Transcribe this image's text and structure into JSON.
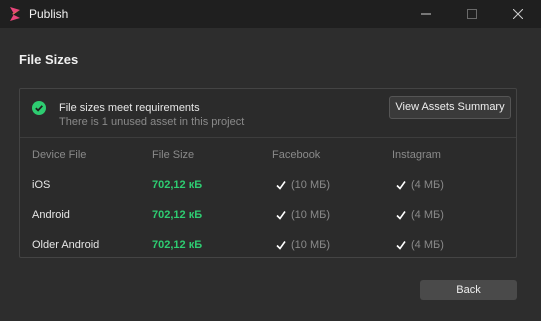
{
  "window": {
    "title": "Publish",
    "icons": {
      "app": "spark-ar-icon",
      "minimize": "minimize-icon",
      "maximize": "maximize-icon",
      "close": "close-icon"
    }
  },
  "page": {
    "title": "File Sizes"
  },
  "status": {
    "title": "File sizes meet requirements",
    "subtitle": "There is 1 unused asset in this project",
    "icon": "check-circle-icon",
    "color": "#2ecc71"
  },
  "summary_button": {
    "label": "View Assets Summary"
  },
  "table": {
    "headers": {
      "device": "Device File",
      "size": "File Size",
      "facebook": "Facebook",
      "instagram": "Instagram"
    },
    "rows": [
      {
        "device": "iOS",
        "size": "702,12 кБ",
        "facebook_limit": "(10 МБ)",
        "instagram_limit": "(4 МБ)"
      },
      {
        "device": "Android",
        "size": "702,12 кБ",
        "facebook_limit": "(10 МБ)",
        "instagram_limit": "(4 МБ)"
      },
      {
        "device": "Older Android",
        "size": "702,12 кБ",
        "facebook_limit": "(10 МБ)",
        "instagram_limit": "(4 МБ)"
      }
    ]
  },
  "back_button": {
    "label": "Back"
  }
}
